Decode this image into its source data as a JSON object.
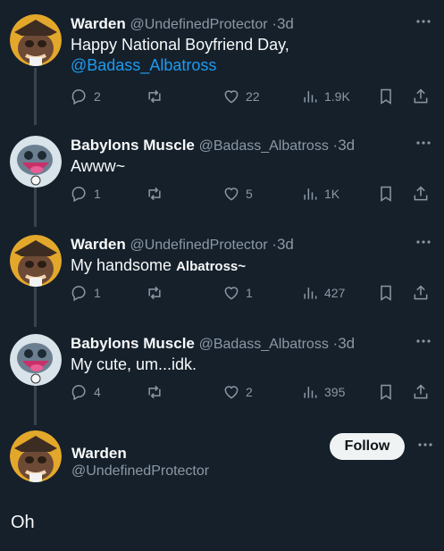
{
  "colors": {
    "background": "#15202b",
    "text": "#f7f9f9",
    "muted": "#8b98a5",
    "mention": "#1d9bf0"
  },
  "tweets": [
    {
      "name": "Warden",
      "handle": "@UndefinedProtector",
      "time": "·3d",
      "text": "Happy National Boyfriend Day,",
      "mention": "@Badass_Albatross",
      "replies": "2",
      "likes": "22",
      "views": "1.9K"
    },
    {
      "name": "Babylons Muscle",
      "handle": "@Badass_Albatross",
      "time": "·3d",
      "text": "Awww~",
      "replies": "1",
      "likes": "5",
      "views": "1K"
    },
    {
      "name": "Warden",
      "handle": "@UndefinedProtector",
      "time": "·3d",
      "text": "My handsome",
      "text_bold": "Albatross~",
      "replies": "1",
      "likes": "1",
      "views": "427"
    },
    {
      "name": "Babylons Muscle",
      "handle": "@Badass_Albatross",
      "time": "·3d",
      "text": "My cute, um...idk.",
      "replies": "4",
      "likes": "2",
      "views": "395"
    }
  ],
  "final": {
    "name": "Warden",
    "handle": "@UndefinedProtector",
    "follow_label": "Follow",
    "text": "Oh"
  },
  "icons": {
    "more": "more-icon",
    "reply": "reply-icon",
    "retweet": "retweet-icon",
    "like": "heart-icon",
    "views": "views-icon",
    "bookmark": "bookmark-icon",
    "share": "share-icon"
  }
}
